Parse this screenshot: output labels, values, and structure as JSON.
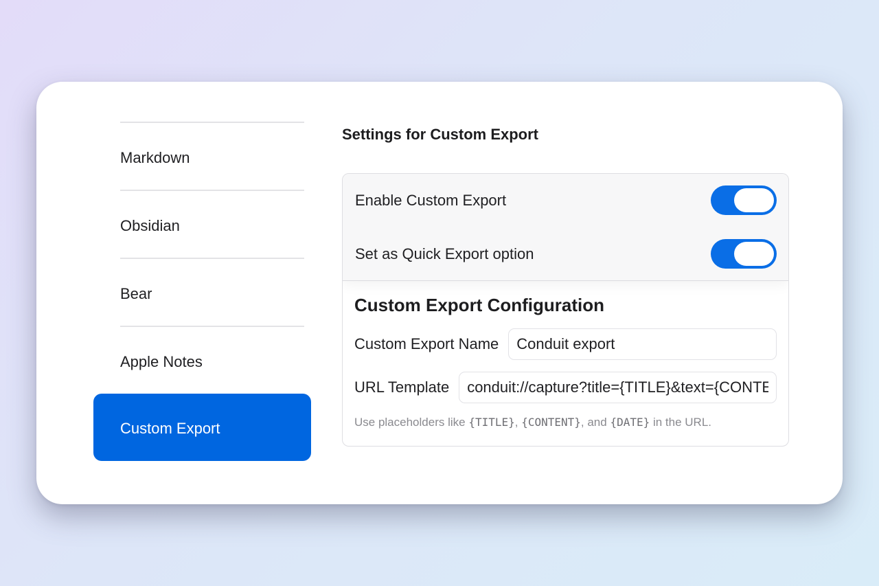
{
  "sidebar": {
    "items": [
      {
        "label": "Markdown"
      },
      {
        "label": "Obsidian"
      },
      {
        "label": "Bear"
      },
      {
        "label": "Apple Notes"
      },
      {
        "label": "Custom Export",
        "active": true
      }
    ]
  },
  "main": {
    "section_title": "Settings for Custom Export",
    "toggles": [
      {
        "label": "Enable Custom Export",
        "on": true
      },
      {
        "label": "Set as Quick Export option",
        "on": true
      }
    ],
    "config": {
      "title": "Custom Export Configuration",
      "name_label": "Custom Export Name",
      "name_value": "Conduit export",
      "url_label": "URL Template",
      "url_value": "conduit://capture?title={TITLE}&text={CONTENT}",
      "hint": {
        "prefix": "Use placeholders like ",
        "ph1": "{TITLE}",
        "sep1": ", ",
        "ph2": "{CONTENT}",
        "sep2": ", and ",
        "ph3": "{DATE}",
        "suffix": " in the URL."
      }
    }
  },
  "colors": {
    "accent": "#0066e0",
    "toggle_on": "#0a6ee6"
  }
}
